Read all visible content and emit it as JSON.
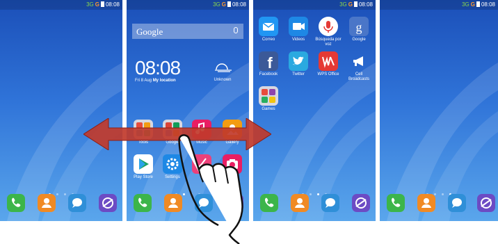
{
  "status_bar": {
    "network": "3G",
    "g": "G",
    "time": "08:08"
  },
  "screen2": {
    "search": {
      "text": "Google"
    },
    "clock": {
      "time": "08:08",
      "date": "Fri 8 Aug",
      "location": "My location"
    },
    "weather": {
      "label": "Unknown"
    },
    "apps": [
      "Tools",
      "Google",
      "Music",
      "Gallery",
      "Play Store",
      "Settings"
    ]
  },
  "screen3": {
    "apps": [
      "Correo",
      "Videos",
      "Búsqueda por voz",
      "Google",
      "Facebook",
      "Twitter",
      "WPS Office",
      "Cell Broadcasts",
      "Games"
    ]
  },
  "dock": [
    "phone-icon",
    "contacts-icon",
    "messages-icon",
    "browser-icon"
  ],
  "colors": {
    "wallpaper": "#2f73d8",
    "arrow": "#c0392b",
    "phone": "#3cb54a",
    "contacts": "#f08a24",
    "messages": "#2f8fd8",
    "browser": "#6c4bc4"
  }
}
